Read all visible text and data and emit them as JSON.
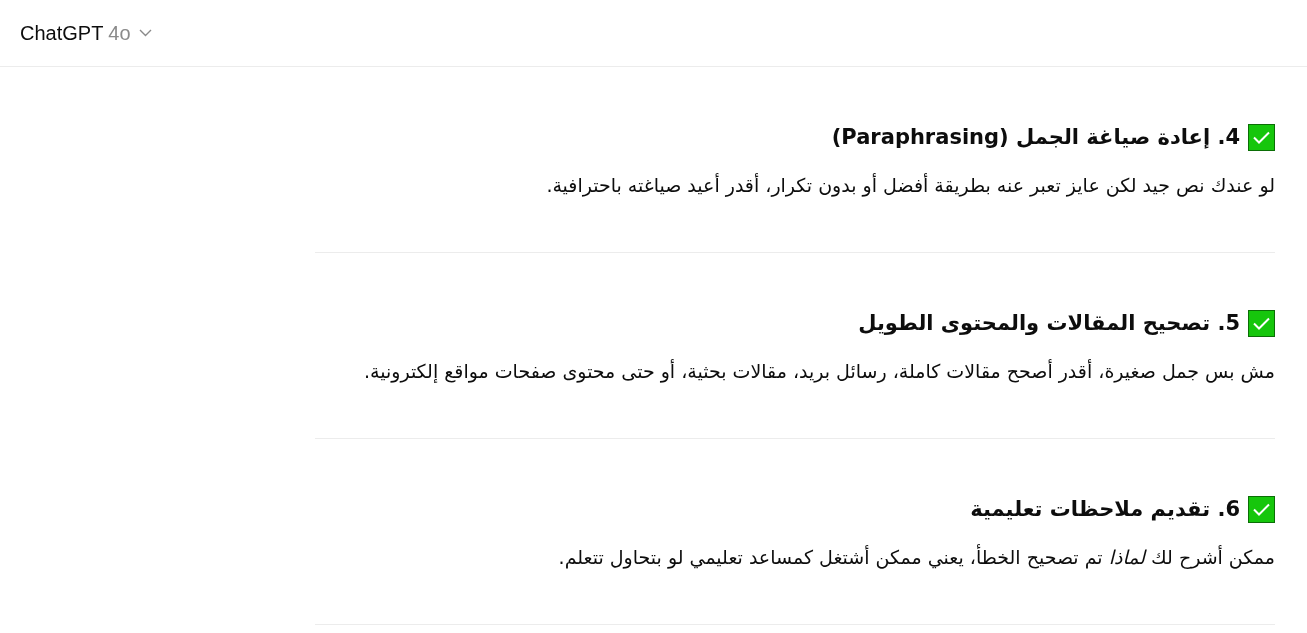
{
  "header": {
    "title": "ChatGPT",
    "model": "4o"
  },
  "sections": [
    {
      "heading": "4. إعادة صياغة الجمل (Paraphrasing)",
      "body": "لو عندك نص جيد لكن عايز تعبر عنه بطريقة أفضل أو بدون تكرار، أقدر أعيد صياغته باحترافية."
    },
    {
      "heading": "5. تصحيح المقالات والمحتوى الطويل",
      "body": "مش بس جمل صغيرة، أقدر أصحح مقالات كاملة، رسائل بريد، مقالات بحثية، أو حتى محتوى صفحات مواقع إلكترونية."
    },
    {
      "heading": "6. تقديم ملاحظات تعليمية",
      "body": "ممكن أشرح لك *لماذا* تم تصحيح الخطأ، يعني ممكن أشتغل كمساعد تعليمي لو بتحاول تتعلم."
    }
  ]
}
